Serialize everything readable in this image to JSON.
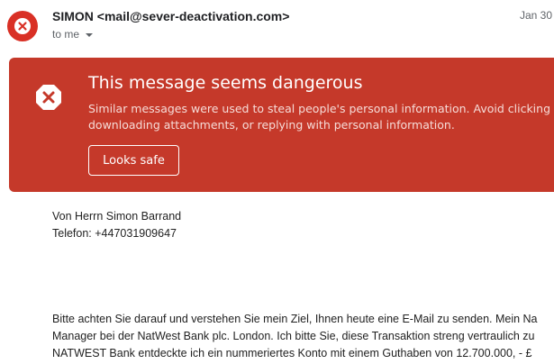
{
  "header": {
    "sender": "SIMON <mail@sever-deactivation.com>",
    "recipient": "to me",
    "date": "Jan 30",
    "avatar_icon": "x-circle-icon",
    "avatar_color": "#d93025"
  },
  "warning_banner": {
    "icon": "x-octagon-icon",
    "title": "This message seems dangerous",
    "description_lines": [
      "Similar messages were used to steal people's personal information. Avoid clicking",
      "downloading attachments, or replying with personal information."
    ],
    "button_label": "Looks safe",
    "background_color": "#c5392a"
  },
  "message": {
    "signature_lines": [
      "Von Herrn Simon Barrand",
      "Telefon: +447031909647"
    ],
    "body_lines": [
      "Bitte achten Sie darauf und verstehen Sie mein Ziel, Ihnen heute eine E-Mail zu senden. Mein Na",
      "Manager bei der NatWest Bank plc. London. Ich bitte Sie, diese Transaktion streng vertraulich zu",
      "NATWEST Bank entdeckte ich ein nummeriertes Konto mit einem Guthaben von 12.700.000, - £"
    ]
  }
}
